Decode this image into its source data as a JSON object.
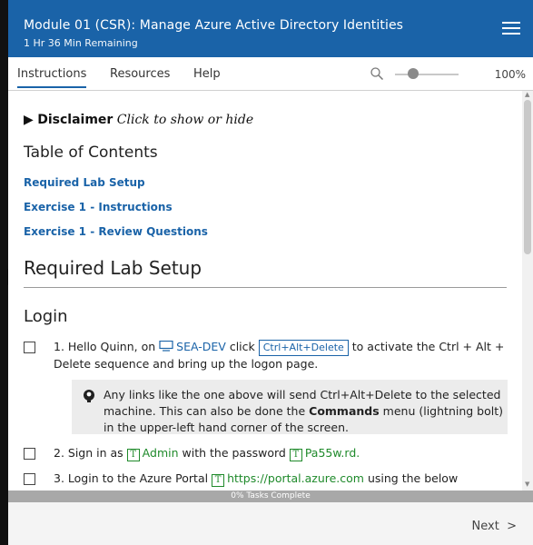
{
  "header": {
    "title": "Module 01 (CSR): Manage Azure Active Directory Identities",
    "time_remaining": "1 Hr 36 Min Remaining",
    "menu_icon": "hamburger-icon"
  },
  "tabs": [
    {
      "label": "Instructions",
      "active": true
    },
    {
      "label": "Resources",
      "active": false
    },
    {
      "label": "Help",
      "active": false
    }
  ],
  "zoom": {
    "value": "100%",
    "icon": "search-icon"
  },
  "content": {
    "disclaimer": {
      "arrow": "▶",
      "label": "Disclaimer",
      "hint": "Click to show or hide"
    },
    "toc_title": "Table of Contents",
    "toc_links": [
      "Required Lab Setup",
      "Exercise 1 - Instructions",
      "Exercise 1 - Review Questions"
    ],
    "section_title": "Required Lab Setup",
    "login_title": "Login",
    "task1": {
      "prefix": "1. Hello Quinn, on",
      "machine": "SEA-DEV",
      "click_word": "click",
      "button": "Ctrl+Alt+Delete",
      "suffix": "to activate the Ctrl + Alt + Delete sequence and bring up the logon page."
    },
    "note": {
      "text_before": "Any links like the one above will send Ctrl+Alt+Delete to the selected machine. This can also be done the",
      "commands": "Commands",
      "text_after": "menu (lightning bolt) in the upper-left hand corner of the screen."
    },
    "task2": {
      "prefix": "2. Sign in as",
      "user": "Admin",
      "middle": "with the password",
      "password": "Pa55w.rd."
    },
    "task3": {
      "prefix": "3. Login to the Azure Portal",
      "url": "https://portal.azure.com",
      "suffix": "using the below"
    }
  },
  "progress": {
    "label": "0% Tasks Complete",
    "value": 0
  },
  "footer": {
    "next_label": "Next",
    "next_icon": "chevron-right-icon"
  },
  "colors": {
    "accent": "#1a63a8",
    "type_text_green": "#1f8a2b",
    "progress_gray": "#a8a8a8"
  }
}
